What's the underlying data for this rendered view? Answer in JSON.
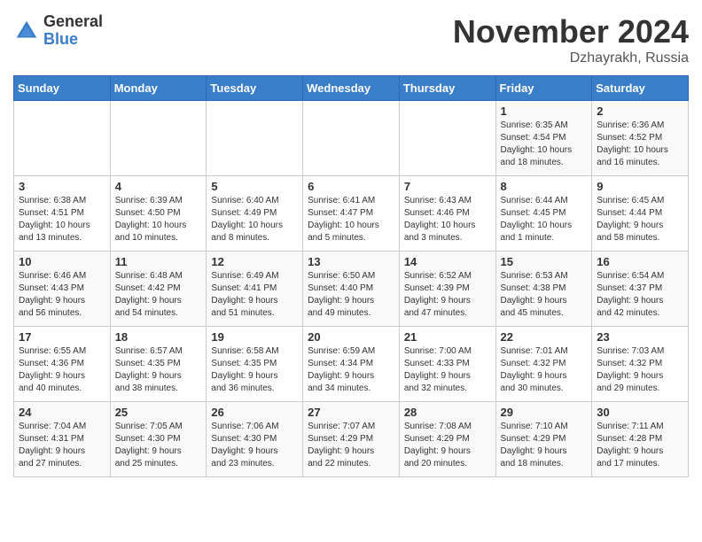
{
  "logo": {
    "general": "General",
    "blue": "Blue"
  },
  "title": "November 2024",
  "location": "Dzhayrakh, Russia",
  "days_of_week": [
    "Sunday",
    "Monday",
    "Tuesday",
    "Wednesday",
    "Thursday",
    "Friday",
    "Saturday"
  ],
  "weeks": [
    [
      {
        "day": "",
        "info": ""
      },
      {
        "day": "",
        "info": ""
      },
      {
        "day": "",
        "info": ""
      },
      {
        "day": "",
        "info": ""
      },
      {
        "day": "",
        "info": ""
      },
      {
        "day": "1",
        "info": "Sunrise: 6:35 AM\nSunset: 4:54 PM\nDaylight: 10 hours\nand 18 minutes."
      },
      {
        "day": "2",
        "info": "Sunrise: 6:36 AM\nSunset: 4:52 PM\nDaylight: 10 hours\nand 16 minutes."
      }
    ],
    [
      {
        "day": "3",
        "info": "Sunrise: 6:38 AM\nSunset: 4:51 PM\nDaylight: 10 hours\nand 13 minutes."
      },
      {
        "day": "4",
        "info": "Sunrise: 6:39 AM\nSunset: 4:50 PM\nDaylight: 10 hours\nand 10 minutes."
      },
      {
        "day": "5",
        "info": "Sunrise: 6:40 AM\nSunset: 4:49 PM\nDaylight: 10 hours\nand 8 minutes."
      },
      {
        "day": "6",
        "info": "Sunrise: 6:41 AM\nSunset: 4:47 PM\nDaylight: 10 hours\nand 5 minutes."
      },
      {
        "day": "7",
        "info": "Sunrise: 6:43 AM\nSunset: 4:46 PM\nDaylight: 10 hours\nand 3 minutes."
      },
      {
        "day": "8",
        "info": "Sunrise: 6:44 AM\nSunset: 4:45 PM\nDaylight: 10 hours\nand 1 minute."
      },
      {
        "day": "9",
        "info": "Sunrise: 6:45 AM\nSunset: 4:44 PM\nDaylight: 9 hours\nand 58 minutes."
      }
    ],
    [
      {
        "day": "10",
        "info": "Sunrise: 6:46 AM\nSunset: 4:43 PM\nDaylight: 9 hours\nand 56 minutes."
      },
      {
        "day": "11",
        "info": "Sunrise: 6:48 AM\nSunset: 4:42 PM\nDaylight: 9 hours\nand 54 minutes."
      },
      {
        "day": "12",
        "info": "Sunrise: 6:49 AM\nSunset: 4:41 PM\nDaylight: 9 hours\nand 51 minutes."
      },
      {
        "day": "13",
        "info": "Sunrise: 6:50 AM\nSunset: 4:40 PM\nDaylight: 9 hours\nand 49 minutes."
      },
      {
        "day": "14",
        "info": "Sunrise: 6:52 AM\nSunset: 4:39 PM\nDaylight: 9 hours\nand 47 minutes."
      },
      {
        "day": "15",
        "info": "Sunrise: 6:53 AM\nSunset: 4:38 PM\nDaylight: 9 hours\nand 45 minutes."
      },
      {
        "day": "16",
        "info": "Sunrise: 6:54 AM\nSunset: 4:37 PM\nDaylight: 9 hours\nand 42 minutes."
      }
    ],
    [
      {
        "day": "17",
        "info": "Sunrise: 6:55 AM\nSunset: 4:36 PM\nDaylight: 9 hours\nand 40 minutes."
      },
      {
        "day": "18",
        "info": "Sunrise: 6:57 AM\nSunset: 4:35 PM\nDaylight: 9 hours\nand 38 minutes."
      },
      {
        "day": "19",
        "info": "Sunrise: 6:58 AM\nSunset: 4:35 PM\nDaylight: 9 hours\nand 36 minutes."
      },
      {
        "day": "20",
        "info": "Sunrise: 6:59 AM\nSunset: 4:34 PM\nDaylight: 9 hours\nand 34 minutes."
      },
      {
        "day": "21",
        "info": "Sunrise: 7:00 AM\nSunset: 4:33 PM\nDaylight: 9 hours\nand 32 minutes."
      },
      {
        "day": "22",
        "info": "Sunrise: 7:01 AM\nSunset: 4:32 PM\nDaylight: 9 hours\nand 30 minutes."
      },
      {
        "day": "23",
        "info": "Sunrise: 7:03 AM\nSunset: 4:32 PM\nDaylight: 9 hours\nand 29 minutes."
      }
    ],
    [
      {
        "day": "24",
        "info": "Sunrise: 7:04 AM\nSunset: 4:31 PM\nDaylight: 9 hours\nand 27 minutes."
      },
      {
        "day": "25",
        "info": "Sunrise: 7:05 AM\nSunset: 4:30 PM\nDaylight: 9 hours\nand 25 minutes."
      },
      {
        "day": "26",
        "info": "Sunrise: 7:06 AM\nSunset: 4:30 PM\nDaylight: 9 hours\nand 23 minutes."
      },
      {
        "day": "27",
        "info": "Sunrise: 7:07 AM\nSunset: 4:29 PM\nDaylight: 9 hours\nand 22 minutes."
      },
      {
        "day": "28",
        "info": "Sunrise: 7:08 AM\nSunset: 4:29 PM\nDaylight: 9 hours\nand 20 minutes."
      },
      {
        "day": "29",
        "info": "Sunrise: 7:10 AM\nSunset: 4:29 PM\nDaylight: 9 hours\nand 18 minutes."
      },
      {
        "day": "30",
        "info": "Sunrise: 7:11 AM\nSunset: 4:28 PM\nDaylight: 9 hours\nand 17 minutes."
      }
    ]
  ]
}
